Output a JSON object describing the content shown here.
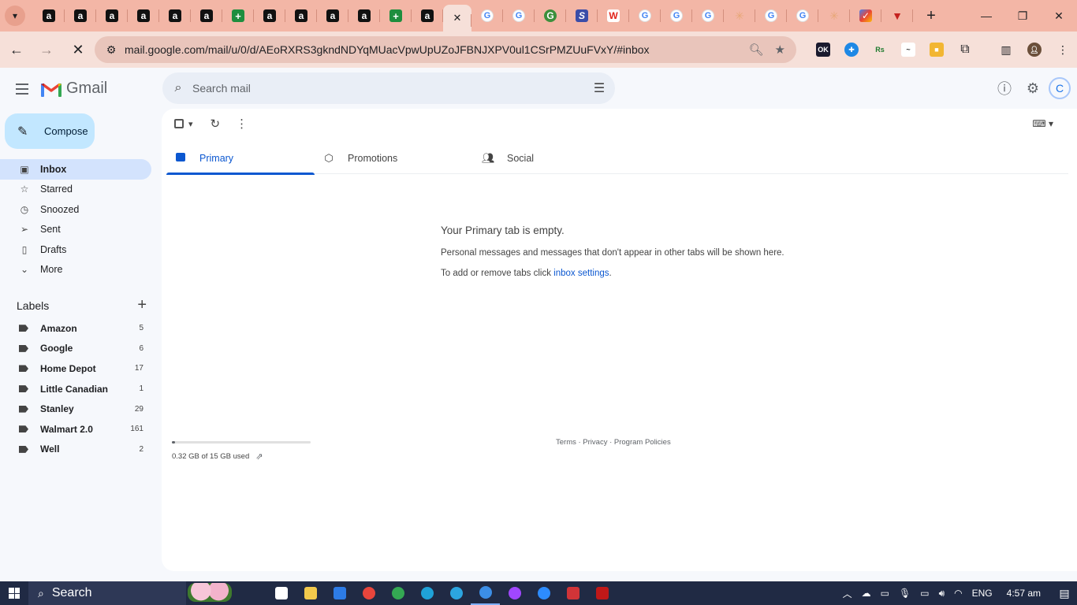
{
  "browser": {
    "tabs": [
      {
        "icon": "amazon-icon",
        "glyph": "a"
      },
      {
        "icon": "amazon-icon",
        "glyph": "a"
      },
      {
        "icon": "amazon-icon",
        "glyph": "a"
      },
      {
        "icon": "amazon-icon",
        "glyph": "a"
      },
      {
        "icon": "amazon-icon",
        "glyph": "a"
      },
      {
        "icon": "amazon-icon",
        "glyph": "a"
      },
      {
        "icon": "sheets-icon",
        "glyph": "+"
      },
      {
        "icon": "amazon-icon",
        "glyph": "a"
      },
      {
        "icon": "amazon-icon",
        "glyph": "a"
      },
      {
        "icon": "amazon-icon",
        "glyph": "a"
      },
      {
        "icon": "amazon-icon",
        "glyph": "a"
      },
      {
        "icon": "sheets-icon",
        "glyph": "+"
      },
      {
        "icon": "amazon-icon",
        "glyph": "a"
      }
    ],
    "tabs_after": [
      {
        "icon": "google-icon",
        "glyph": "G"
      },
      {
        "icon": "google-icon",
        "glyph": "G"
      },
      {
        "icon": "grammarly-icon",
        "glyph": "G"
      },
      {
        "icon": "sports-icon",
        "glyph": "S"
      },
      {
        "icon": "walgreens-icon",
        "glyph": "W"
      },
      {
        "icon": "google-icon",
        "glyph": "G"
      },
      {
        "icon": "google-icon",
        "glyph": "G"
      },
      {
        "icon": "google-icon",
        "glyph": "G"
      },
      {
        "icon": "star-icon",
        "glyph": "✳"
      },
      {
        "icon": "google-icon",
        "glyph": "G"
      },
      {
        "icon": "google-icon",
        "glyph": "G"
      },
      {
        "icon": "star-icon",
        "glyph": "✳"
      },
      {
        "icon": "multicolor-icon",
        "glyph": "✓"
      },
      {
        "icon": "triangle-icon",
        "glyph": "▼"
      }
    ],
    "url": "mail.google.com/mail/u/0/d/AEoRXRS3gkndNDYqMUacVpwUpUZoJFBNJXPV0ul1CSrPMZUuFVxY/#inbox"
  },
  "gmail": {
    "app_name": "Gmail",
    "search_placeholder": "Search mail",
    "compose_label": "Compose",
    "avatar_initial": "C",
    "nav": [
      {
        "label": "Inbox",
        "icon": "inbox-icon",
        "active": true
      },
      {
        "label": "Starred",
        "icon": "star-icon"
      },
      {
        "label": "Snoozed",
        "icon": "clock-icon"
      },
      {
        "label": "Sent",
        "icon": "send-icon"
      },
      {
        "label": "Drafts",
        "icon": "draft-icon"
      },
      {
        "label": "More",
        "icon": "chevron-down-icon"
      }
    ],
    "labels_title": "Labels",
    "labels": [
      {
        "name": "Amazon",
        "count": "5"
      },
      {
        "name": "Google",
        "count": "6"
      },
      {
        "name": "Home Depot",
        "count": "17"
      },
      {
        "name": "Little Canadian",
        "count": "1"
      },
      {
        "name": "Stanley",
        "count": "29"
      },
      {
        "name": "Walmart 2.0",
        "count": "161"
      },
      {
        "name": "Well",
        "count": "2"
      }
    ],
    "tabs": [
      {
        "label": "Primary",
        "icon": "inbox-icon",
        "active": true
      },
      {
        "label": "Promotions",
        "icon": "tag-icon"
      },
      {
        "label": "Social",
        "icon": "people-icon"
      }
    ],
    "empty": {
      "title": "Your Primary tab is empty.",
      "line1": "Personal messages and messages that don't appear in other tabs will be shown here.",
      "line2_prefix": "To add or remove tabs click ",
      "line2_link": "inbox settings",
      "line2_suffix": "."
    },
    "storage": {
      "text": "0.32 GB of 15 GB used",
      "used_fraction": 0.021
    },
    "footer": "Terms · Privacy · Program Policies"
  },
  "taskbar": {
    "search_label": "Search",
    "language": "ENG",
    "time": "4:57 am",
    "apps": [
      {
        "name": "task-view",
        "color": "#ffffff"
      },
      {
        "name": "file-explorer",
        "color": "#f2c94c"
      },
      {
        "name": "mail",
        "color": "#2d7be5"
      },
      {
        "name": "chrome",
        "color": "#e8453c"
      },
      {
        "name": "chrome-profile",
        "color": "#34a853"
      },
      {
        "name": "edge",
        "color": "#1fa2d8"
      },
      {
        "name": "telegram",
        "color": "#2ca5e0"
      },
      {
        "name": "chrome-active",
        "color": "#3c8ee6"
      },
      {
        "name": "messenger",
        "color": "#a047ff"
      },
      {
        "name": "zoom",
        "color": "#2d8cff"
      },
      {
        "name": "app-red",
        "color": "#d13438"
      },
      {
        "name": "mcafee",
        "color": "#c01818"
      }
    ]
  }
}
